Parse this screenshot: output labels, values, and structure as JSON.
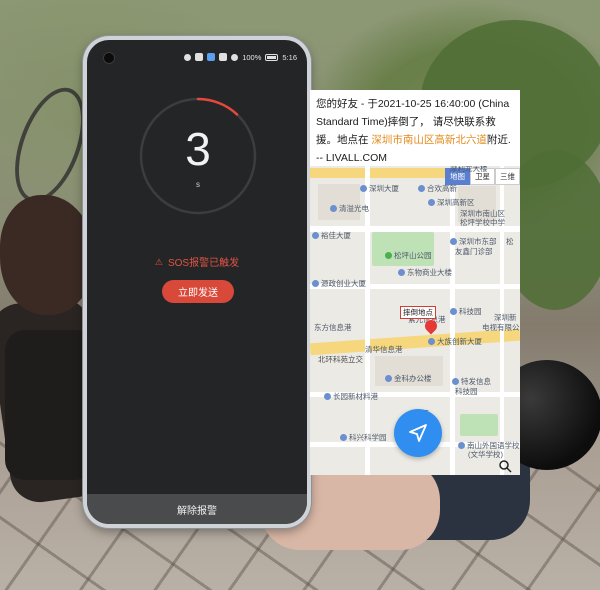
{
  "phone": {
    "status": {
      "battery_text": "100%",
      "time": "5:16"
    },
    "countdown": {
      "number": "3",
      "unit": "s",
      "progress_fraction": 0.12,
      "arc_color": "#e5483a"
    },
    "sos_status": "SOS报警已触发",
    "send_now_label": "立即发送",
    "cancel_label": "解除报警",
    "accent_color": "#d8493a"
  },
  "message": {
    "prefix": "您的好友 - 于2021-10-25 16:40:00 (China Standard Time)摔倒了， 请尽快联系救援。地点在 ",
    "address": "深圳市南山区高新北六道",
    "suffix": "附近. -- LIVALL.COM"
  },
  "map": {
    "tabs": [
      "地图",
      "卫星",
      "三维"
    ],
    "fall_label": "摔倒地点",
    "pois": {
      "p1": "深圳大厦",
      "p2": "合欢高新",
      "p3": "深圳高新区",
      "p4": "深圳市南山区",
      "p5": "松坪学校中学",
      "p6": "清溢光电",
      "p7": "松坪山公园",
      "p8": "深圳市东部",
      "p9": "友鑫门诊部",
      "p10": "裕佳大厦",
      "p11": "东物商业大楼",
      "p12": "源政创业大厦",
      "p13": "紫光信息港",
      "p14": "科技园",
      "p15": "东方信息港",
      "p16": "清华信息港",
      "p17": "大族创新大厦",
      "p18": "深圳新",
      "p19": "电视有限公司",
      "p20": "北环科苑立交",
      "p21": "金科办公楼",
      "p22": "特发信息",
      "p23": "科技园",
      "p24": "长园新材料港",
      "p25": "科兴科学园",
      "p26": "南山外国语学校",
      "p27": "(文华学校)",
      "p28": "元征",
      "p29": "松",
      "p30": "摩利龙大楼"
    }
  }
}
